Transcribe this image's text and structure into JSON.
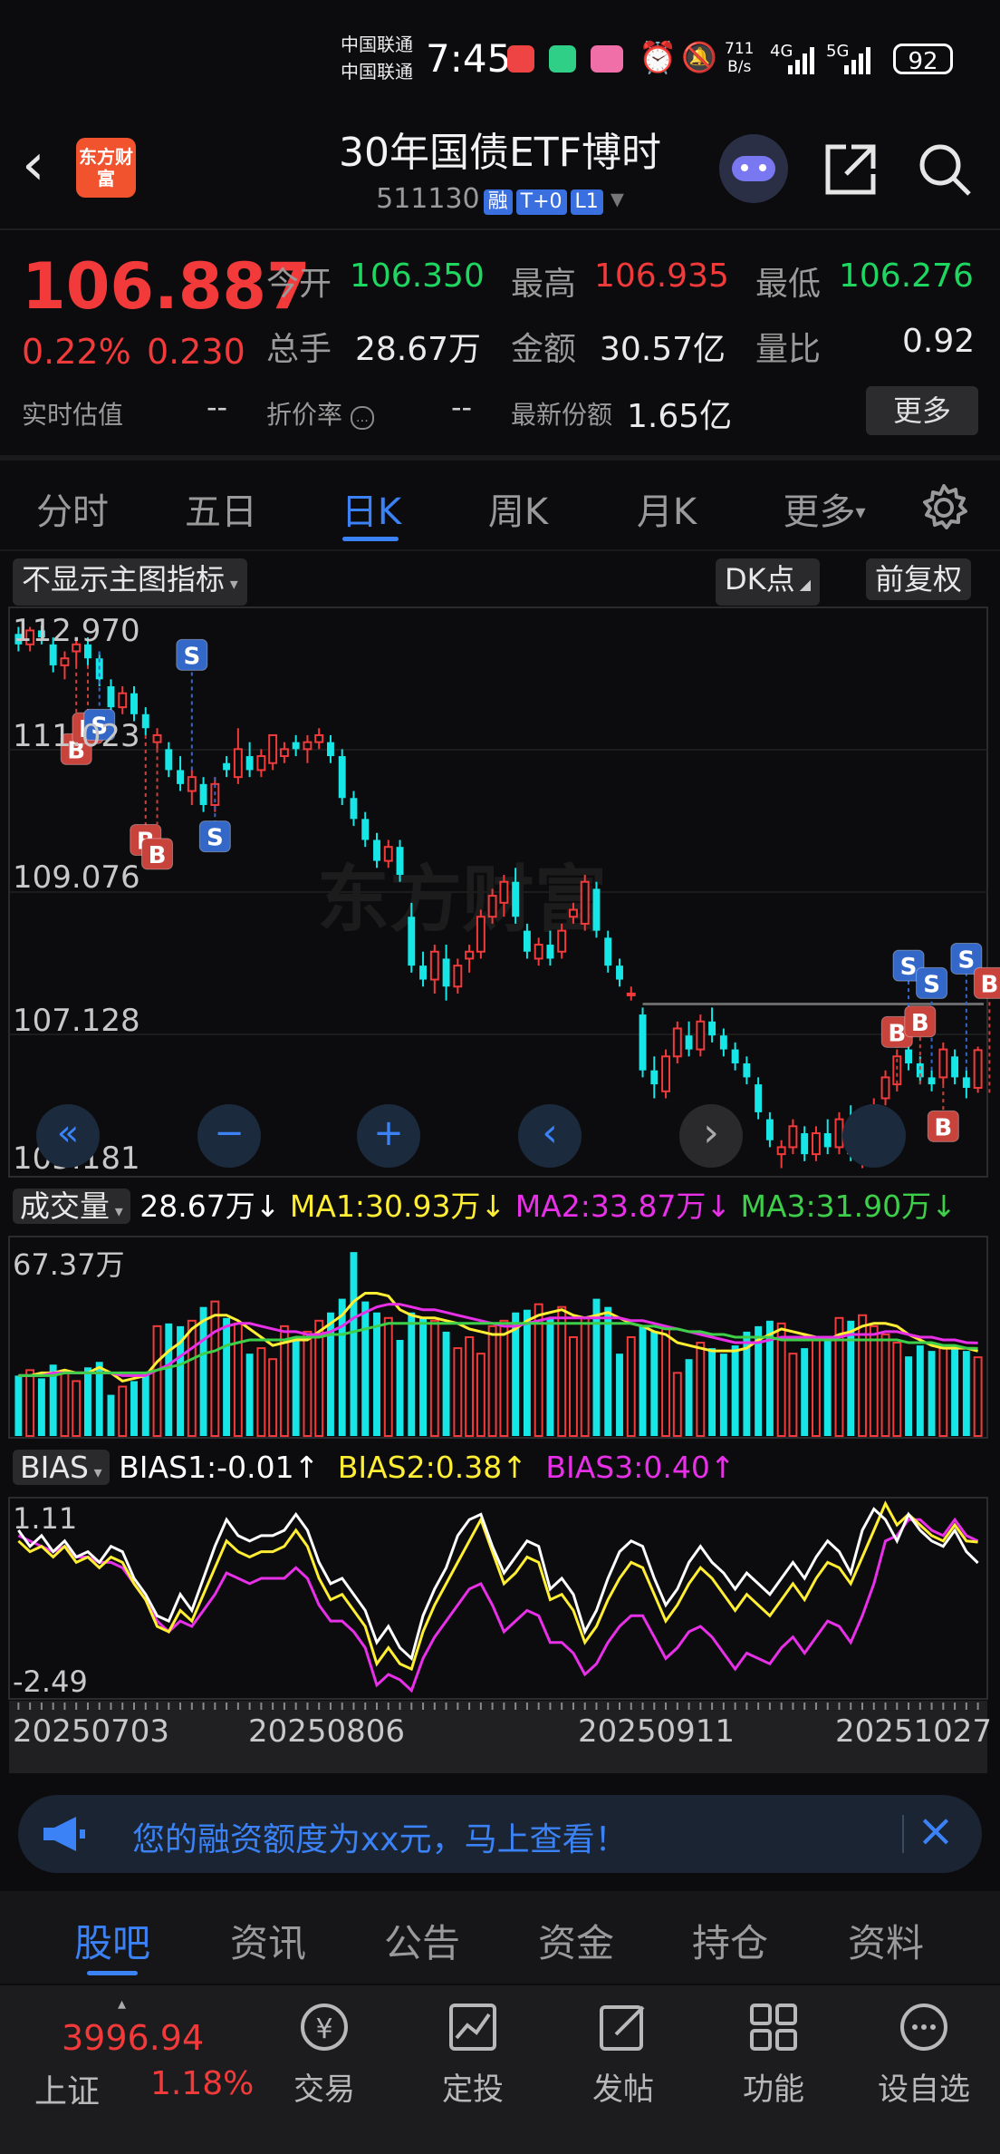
{
  "status_bar": {
    "carrier1": "中国联通",
    "carrier2": "中国联通",
    "time": "7:45",
    "net_speed": "711",
    "net_unit": "B/s",
    "net1": "4G",
    "net2": "5G",
    "battery": "92"
  },
  "header": {
    "logo_text": "东方财富",
    "title": "30年国债ETF博时",
    "code": "511130",
    "badges": [
      "融",
      "T+0",
      "L1"
    ]
  },
  "quote": {
    "price": "106.887",
    "change_pct": "0.22%",
    "change": "0.230",
    "open_label": "今开",
    "open": "106.350",
    "high_label": "最高",
    "high": "106.935",
    "low_label": "最低",
    "low": "106.276",
    "volume_label": "总手",
    "volume": "28.67万",
    "amount_label": "金额",
    "amount": "30.57亿",
    "ratio_label": "量比",
    "ratio": "0.92",
    "iopv_label": "实时估值",
    "iopv": "--",
    "premium_label": "折价率",
    "premium": "--",
    "shares_label": "最新份额",
    "shares": "1.65亿",
    "more_label": "更多"
  },
  "tabs": [
    "分时",
    "五日",
    "日K",
    "周K",
    "月K",
    "更多"
  ],
  "active_tab": "日K",
  "chart_controls": {
    "indicator_toggle": "不显示主图指标",
    "dk_label": "DK点",
    "adjust_label": "前复权"
  },
  "chart_data": [
    {
      "type": "candlestick",
      "y_ticks": [
        "112.970",
        "111.023",
        "109.076",
        "107.128",
        "105.181"
      ],
      "ylim": [
        105.181,
        112.97
      ],
      "x_ticks": [
        "20250703",
        "20250806",
        "20250911",
        "20251027"
      ],
      "candles": [
        [
          112.85,
          112.95,
          112.6,
          112.7
        ],
        [
          112.7,
          112.95,
          112.6,
          112.9
        ],
        [
          112.9,
          112.97,
          112.7,
          112.8
        ],
        [
          112.7,
          112.8,
          112.3,
          112.4
        ],
        [
          112.4,
          112.6,
          112.2,
          112.5
        ],
        [
          112.6,
          112.8,
          112.4,
          112.7
        ],
        [
          112.7,
          112.8,
          112.4,
          112.5
        ],
        [
          112.5,
          112.6,
          112.1,
          112.2
        ],
        [
          112.1,
          112.2,
          111.7,
          111.8
        ],
        [
          111.8,
          112.1,
          111.7,
          112.0
        ],
        [
          112.0,
          112.1,
          111.6,
          111.7
        ],
        [
          111.7,
          111.8,
          111.4,
          111.5
        ],
        [
          111.3,
          111.5,
          111.2,
          111.4
        ],
        [
          111.2,
          111.3,
          110.8,
          110.9
        ],
        [
          110.9,
          111.1,
          110.6,
          110.7
        ],
        [
          110.6,
          110.9,
          110.4,
          110.8
        ],
        [
          110.7,
          110.8,
          110.3,
          110.4
        ],
        [
          110.4,
          110.8,
          110.3,
          110.7
        ],
        [
          111.0,
          111.1,
          110.8,
          110.9
        ],
        [
          110.8,
          111.5,
          110.7,
          111.2
        ],
        [
          111.1,
          111.3,
          110.8,
          110.9
        ],
        [
          110.9,
          111.2,
          110.8,
          111.1
        ],
        [
          111.0,
          111.3,
          110.9,
          111.4
        ],
        [
          111.1,
          111.3,
          111.0,
          111.2
        ],
        [
          111.3,
          111.4,
          111.1,
          111.2
        ],
        [
          111.2,
          111.4,
          111.0,
          111.3
        ],
        [
          111.3,
          111.5,
          111.2,
          111.4
        ],
        [
          111.3,
          111.4,
          111.0,
          111.1
        ],
        [
          111.1,
          111.2,
          110.4,
          110.5
        ],
        [
          110.5,
          110.6,
          110.1,
          110.2
        ],
        [
          110.2,
          110.3,
          109.8,
          109.9
        ],
        [
          109.9,
          110.0,
          109.5,
          109.6
        ],
        [
          109.6,
          109.9,
          109.5,
          109.8
        ],
        [
          109.8,
          109.9,
          109.3,
          109.4
        ],
        [
          108.8,
          109.0,
          108.0,
          108.1
        ],
        [
          108.1,
          108.3,
          107.8,
          107.9
        ],
        [
          107.9,
          108.4,
          107.7,
          108.3
        ],
        [
          108.2,
          108.4,
          107.6,
          107.8
        ],
        [
          107.8,
          108.2,
          107.7,
          108.1
        ],
        [
          108.2,
          108.4,
          108.0,
          108.3
        ],
        [
          108.3,
          108.9,
          108.2,
          108.8
        ],
        [
          108.8,
          109.2,
          108.7,
          109.1
        ],
        [
          109.0,
          109.4,
          108.8,
          109.3
        ],
        [
          109.3,
          109.5,
          108.7,
          108.8
        ],
        [
          108.6,
          108.7,
          108.2,
          108.3
        ],
        [
          108.2,
          108.5,
          108.1,
          108.4
        ],
        [
          108.4,
          108.6,
          108.1,
          108.2
        ],
        [
          108.3,
          108.7,
          108.2,
          108.6
        ],
        [
          108.8,
          109.0,
          108.7,
          108.9
        ],
        [
          108.7,
          109.4,
          108.6,
          109.3
        ],
        [
          109.2,
          109.3,
          108.5,
          108.6
        ],
        [
          108.5,
          108.6,
          108.0,
          108.1
        ],
        [
          108.1,
          108.2,
          107.8,
          107.9
        ],
        [
          107.7,
          107.8,
          107.6,
          107.7
        ],
        [
          107.4,
          107.5,
          106.5,
          106.6
        ],
        [
          106.6,
          106.8,
          106.2,
          106.4
        ],
        [
          106.3,
          106.9,
          106.2,
          106.8
        ],
        [
          106.8,
          107.3,
          106.7,
          107.2
        ],
        [
          107.1,
          107.3,
          106.8,
          106.9
        ],
        [
          106.9,
          107.4,
          106.8,
          107.3
        ],
        [
          107.3,
          107.5,
          107.0,
          107.1
        ],
        [
          107.1,
          107.2,
          106.8,
          106.9
        ],
        [
          106.9,
          107.0,
          106.6,
          106.7
        ],
        [
          106.7,
          106.8,
          106.4,
          106.5
        ],
        [
          106.4,
          106.5,
          105.9,
          106.0
        ],
        [
          105.9,
          106.0,
          105.5,
          105.6
        ],
        [
          105.4,
          105.6,
          105.2,
          105.5
        ],
        [
          105.5,
          105.9,
          105.4,
          105.8
        ],
        [
          105.7,
          105.8,
          105.3,
          105.4
        ],
        [
          105.4,
          105.8,
          105.3,
          105.7
        ],
        [
          105.7,
          105.9,
          105.4,
          105.5
        ],
        [
          105.5,
          106.0,
          105.4,
          105.9
        ],
        [
          105.9,
          106.1,
          105.3,
          105.4
        ],
        [
          105.4,
          105.6,
          105.2,
          105.5
        ],
        [
          105.5,
          106.2,
          105.4,
          106.1
        ],
        [
          106.2,
          106.6,
          106.1,
          106.5
        ],
        [
          106.4,
          106.9,
          106.3,
          106.8
        ],
        [
          106.9,
          107.1,
          106.6,
          106.7
        ],
        [
          106.7,
          106.8,
          106.4,
          106.5
        ],
        [
          106.5,
          106.6,
          106.3,
          106.4
        ],
        [
          106.5,
          107.0,
          106.4,
          106.9
        ],
        [
          106.8,
          106.9,
          106.4,
          106.5
        ],
        [
          106.5,
          106.6,
          106.2,
          106.35
        ],
        [
          106.35,
          106.94,
          106.28,
          106.89
        ]
      ],
      "reference_line": 107.55,
      "signals": [
        {
          "type": "B",
          "index": 5,
          "price": 111.2
        },
        {
          "type": "B",
          "index": 6,
          "price": 111.5
        },
        {
          "type": "S",
          "index": 7,
          "price": 111.55
        },
        {
          "type": "B",
          "index": 11,
          "price": 109.9
        },
        {
          "type": "B",
          "index": 12,
          "price": 109.7
        },
        {
          "type": "S",
          "index": 15,
          "price": 112.55
        },
        {
          "type": "S",
          "index": 17,
          "price": 109.95
        },
        {
          "type": "S",
          "index": 77,
          "price": 108.1
        },
        {
          "type": "S",
          "index": 79,
          "price": 107.85
        },
        {
          "type": "S",
          "index": 82,
          "price": 108.2
        },
        {
          "type": "B",
          "index": 84,
          "price": 107.85
        },
        {
          "type": "B",
          "index": 76,
          "price": 107.15
        },
        {
          "type": "B",
          "index": 78,
          "price": 107.3
        },
        {
          "type": "B",
          "index": 80,
          "price": 105.8
        }
      ]
    },
    {
      "type": "bar",
      "name": "成交量",
      "ylabel": "67.37万",
      "ylim": [
        0,
        67.37
      ],
      "legend": {
        "label": "成交量",
        "vol": "28.67万↓",
        "ma1": "MA1:30.93万↓",
        "ma2": "MA2:33.87万↓",
        "ma3": "MA3:31.90万↓"
      },
      "values": [
        22,
        24,
        21,
        26,
        23,
        20,
        25,
        27,
        15,
        18,
        20,
        23,
        40,
        41,
        40,
        42,
        47,
        49,
        43,
        41,
        30,
        32,
        28,
        40,
        36,
        38,
        42,
        45,
        50,
        67,
        49,
        45,
        43,
        35,
        45,
        43,
        42,
        38,
        32,
        36,
        30,
        40,
        42,
        45,
        46,
        48,
        43,
        47,
        36,
        43,
        50,
        47,
        30,
        36,
        40,
        38,
        39,
        23,
        28,
        34,
        32,
        30,
        33,
        38,
        40,
        42,
        41,
        30,
        32,
        36,
        36,
        43,
        42,
        44,
        40,
        37,
        34,
        29,
        33,
        31,
        32,
        33,
        31,
        28.67
      ],
      "ma1": [
        22,
        22,
        23,
        23,
        24,
        23,
        23,
        25,
        23,
        20,
        21,
        22,
        27,
        31,
        34,
        39,
        42,
        44,
        44,
        42,
        39,
        36,
        33,
        34,
        35,
        35,
        38,
        41,
        44,
        49,
        52,
        52,
        51,
        46,
        44,
        43,
        43,
        42,
        41,
        39,
        38,
        37,
        37,
        39,
        42,
        44,
        45,
        46,
        44,
        43,
        44,
        45,
        43,
        41,
        40,
        38,
        37,
        34,
        33,
        32,
        31,
        31,
        31,
        32,
        35,
        37,
        39,
        38,
        37,
        36,
        35,
        37,
        38,
        40,
        41,
        41,
        40,
        37,
        35,
        33,
        32,
        32,
        32,
        30.93
      ],
      "ma2": [
        22,
        22,
        22,
        23,
        23,
        23,
        23,
        23,
        23,
        22,
        22,
        22,
        24,
        26,
        29,
        32,
        35,
        38,
        40,
        41,
        41,
        40,
        39,
        38,
        38,
        37,
        37,
        38,
        40,
        43,
        45,
        47,
        48,
        48,
        47,
        46,
        46,
        45,
        44,
        43,
        42,
        41,
        40,
        40,
        41,
        42,
        43,
        43,
        43,
        43,
        43,
        43,
        43,
        42,
        42,
        41,
        40,
        39,
        38,
        37,
        36,
        35,
        34,
        34,
        34,
        35,
        36,
        36,
        36,
        36,
        36,
        36,
        37,
        37,
        37,
        38,
        38,
        37,
        36,
        36,
        35,
        35,
        34,
        33.87
      ],
      "ma3": [
        22,
        22,
        22,
        22,
        23,
        23,
        23,
        23,
        23,
        23,
        23,
        23,
        24,
        25,
        26,
        28,
        30,
        31,
        33,
        34,
        35,
        35,
        35,
        35,
        36,
        36,
        36,
        37,
        37,
        38,
        39,
        40,
        41,
        41,
        41,
        41,
        41,
        41,
        41,
        41,
        41,
        41,
        41,
        41,
        41,
        41,
        41,
        41,
        41,
        41,
        41,
        41,
        41,
        41,
        40,
        40,
        39,
        39,
        38,
        38,
        37,
        37,
        36,
        36,
        36,
        36,
        35,
        35,
        35,
        35,
        35,
        35,
        35,
        35,
        35,
        35,
        35,
        34,
        34,
        34,
        33,
        33,
        32,
        31.9
      ]
    },
    {
      "type": "line",
      "name": "BIAS",
      "ylim": [
        -2.49,
        1.11
      ],
      "y_ticks": [
        "1.11",
        "-2.49"
      ],
      "legend": {
        "label": "BIAS",
        "bias1": "BIAS1:-0.01↑",
        "bias2": "BIAS2:0.38↑",
        "bias3": "BIAS3:0.40↑"
      },
      "bias1": [
        0.6,
        0.3,
        0.5,
        0.2,
        0.4,
        0.1,
        0.2,
        0.0,
        0.3,
        0.2,
        -0.3,
        -0.6,
        -1.0,
        -1.1,
        -0.6,
        -0.9,
        -0.3,
        0.3,
        0.8,
        0.5,
        0.4,
        0.5,
        0.5,
        0.6,
        0.9,
        0.6,
        0.0,
        -0.4,
        -0.3,
        -0.6,
        -0.9,
        -1.5,
        -1.2,
        -1.6,
        -1.8,
        -1.0,
        -0.5,
        -0.1,
        0.5,
        0.8,
        0.9,
        0.3,
        -0.2,
        0.1,
        0.4,
        0.3,
        -0.5,
        -0.3,
        -0.6,
        -1.3,
        -0.9,
        -0.3,
        0.2,
        0.4,
        0.3,
        -0.3,
        -0.8,
        -0.5,
        0.0,
        0.3,
        0.0,
        -0.2,
        -0.5,
        -0.2,
        -0.4,
        -0.6,
        -0.3,
        0.0,
        -0.3,
        0.1,
        0.4,
        0.2,
        -0.2,
        0.6,
        1.0,
        0.8,
        0.4,
        0.9,
        0.6,
        0.4,
        0.3,
        0.6,
        0.2,
        -0.01
      ],
      "bias2": [
        0.4,
        0.2,
        0.3,
        0.1,
        0.3,
        0.0,
        0.1,
        -0.1,
        0.1,
        0.0,
        -0.4,
        -0.7,
        -1.2,
        -1.3,
        -0.9,
        -1.1,
        -0.6,
        -0.1,
        0.4,
        0.2,
        0.1,
        0.2,
        0.2,
        0.3,
        0.6,
        0.3,
        -0.3,
        -0.7,
        -0.6,
        -0.9,
        -1.2,
        -1.9,
        -1.6,
        -1.9,
        -2.0,
        -1.3,
        -0.8,
        -0.4,
        0.0,
        0.4,
        0.8,
        0.2,
        -0.4,
        -0.2,
        0.1,
        0.0,
        -0.7,
        -0.6,
        -0.9,
        -1.5,
        -1.2,
        -0.7,
        -0.3,
        0.0,
        -0.1,
        -0.6,
        -1.1,
        -0.8,
        -0.4,
        -0.1,
        -0.3,
        -0.6,
        -0.9,
        -0.6,
        -0.8,
        -1.0,
        -0.7,
        -0.4,
        -0.7,
        -0.3,
        0.0,
        -0.1,
        -0.4,
        0.1,
        0.6,
        1.1,
        0.7,
        0.9,
        0.7,
        0.5,
        0.4,
        0.7,
        0.4,
        0.38
      ],
      "bias3": [
        0.5,
        0.4,
        0.3,
        0.2,
        0.3,
        0.1,
        0.1,
        0.0,
        0.0,
        -0.1,
        -0.4,
        -0.7,
        -1.1,
        -1.3,
        -1.1,
        -1.2,
        -0.9,
        -0.6,
        -0.2,
        -0.3,
        -0.4,
        -0.3,
        -0.3,
        -0.3,
        -0.1,
        -0.3,
        -0.8,
        -1.1,
        -1.1,
        -1.3,
        -1.6,
        -2.3,
        -2.1,
        -2.2,
        -2.4,
        -1.8,
        -1.4,
        -1.1,
        -0.8,
        -0.5,
        -0.4,
        -0.8,
        -1.3,
        -1.1,
        -0.9,
        -1.0,
        -1.5,
        -1.5,
        -1.7,
        -2.1,
        -1.9,
        -1.5,
        -1.2,
        -1.0,
        -1.0,
        -1.4,
        -1.8,
        -1.6,
        -1.3,
        -1.2,
        -1.4,
        -1.7,
        -2.0,
        -1.7,
        -1.8,
        -1.9,
        -1.6,
        -1.4,
        -1.7,
        -1.4,
        -1.1,
        -1.2,
        -1.5,
        -1.0,
        -0.4,
        0.4,
        0.5,
        0.8,
        0.8,
        0.6,
        0.5,
        0.8,
        0.5,
        0.4
      ]
    }
  ],
  "nav_buttons": [
    "«",
    "−",
    "+",
    "‹",
    "›"
  ],
  "banner": {
    "text": "您的融资额度为xx元，马上查看！",
    "close": "×"
  },
  "bottom_tabs": [
    "股吧",
    "资讯",
    "公告",
    "资金",
    "持仓",
    "资料"
  ],
  "active_bottom_tab": "股吧",
  "index_widget": {
    "value": "3996.94",
    "name": "上证",
    "change": "1.18%"
  },
  "toolbar": [
    {
      "label": "交易",
      "icon": "trade-icon"
    },
    {
      "label": "定投",
      "icon": "invest-icon"
    },
    {
      "label": "发帖",
      "icon": "post-icon"
    },
    {
      "label": "功能",
      "icon": "grid-icon"
    },
    {
      "label": "设自选",
      "icon": "more-icon"
    }
  ],
  "colors": {
    "up": "#f23a3a",
    "down": "#16e6e6",
    "accent": "#3b82f6",
    "ma1": "#ffee33",
    "ma2": "#e830e8",
    "ma3": "#3ecf4a"
  }
}
